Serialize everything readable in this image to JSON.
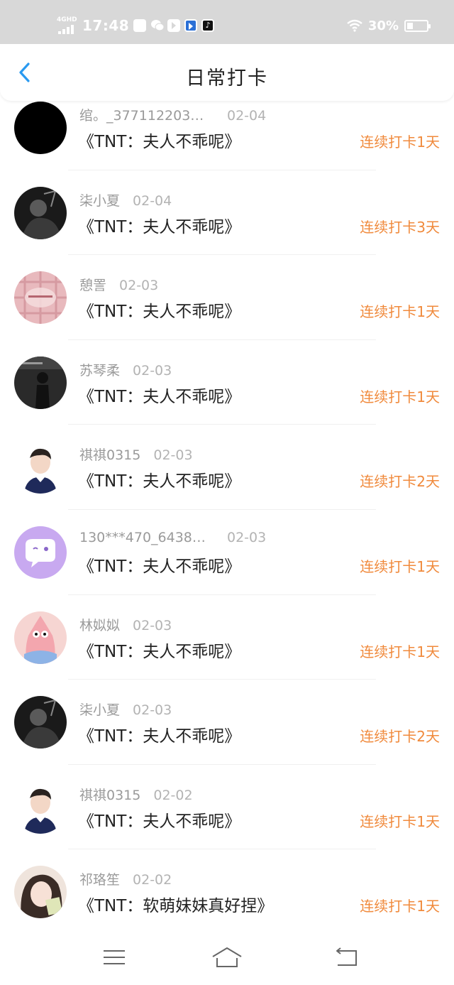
{
  "status_bar": {
    "network": "4GHD",
    "time": "17:48",
    "battery_text": "30%",
    "battery_level": 0.3
  },
  "header": {
    "title": "日常打卡"
  },
  "records": [
    {
      "name": "绾。_377112203…",
      "date": "02-04",
      "book": "《TNT：夫人不乖呢》",
      "streak": "连续打卡1天",
      "avatar": "black-circle"
    },
    {
      "name": "柒小夏",
      "date": "02-04",
      "book": "《TNT：夫人不乖呢》",
      "streak": "连续打卡3天",
      "avatar": "dark-photo"
    },
    {
      "name": "憩詈",
      "date": "02-03",
      "book": "《TNT：夫人不乖呢》",
      "streak": "连续打卡1天",
      "avatar": "pink-plaid"
    },
    {
      "name": "苏琴柔",
      "date": "02-03",
      "book": "《TNT：夫人不乖呢》",
      "streak": "连续打卡1天",
      "avatar": "dark-figure"
    },
    {
      "name": "祺祺0315",
      "date": "02-03",
      "book": "《TNT：夫人不乖呢》",
      "streak": "连续打卡2天",
      "avatar": "boy-portrait"
    },
    {
      "name": "130***470_6438…",
      "date": "02-03",
      "book": "《TNT：夫人不乖呢》",
      "streak": "连续打卡1天",
      "avatar": "purple-chat-bubble"
    },
    {
      "name": "林姒姒",
      "date": "02-03",
      "book": "《TNT：夫人不乖呢》",
      "streak": "连续打卡1天",
      "avatar": "patrick-star"
    },
    {
      "name": "柒小夏",
      "date": "02-03",
      "book": "《TNT：夫人不乖呢》",
      "streak": "连续打卡2天",
      "avatar": "dark-photo"
    },
    {
      "name": "祺祺0315",
      "date": "02-02",
      "book": "《TNT：夫人不乖呢》",
      "streak": "连续打卡1天",
      "avatar": "boy-portrait"
    },
    {
      "name": "祁珞笙",
      "date": "02-02",
      "book": "《TNT：软萌妹妹真好捏》",
      "streak": "连续打卡1天",
      "avatar": "girl-selfie"
    }
  ],
  "colors": {
    "accent_back": "#2a9af0",
    "streak": "#f08a3c",
    "status_bar_bg": "#d8d8d8"
  },
  "nav": {
    "icons": [
      "menu-icon",
      "home-icon",
      "back-icon"
    ]
  }
}
